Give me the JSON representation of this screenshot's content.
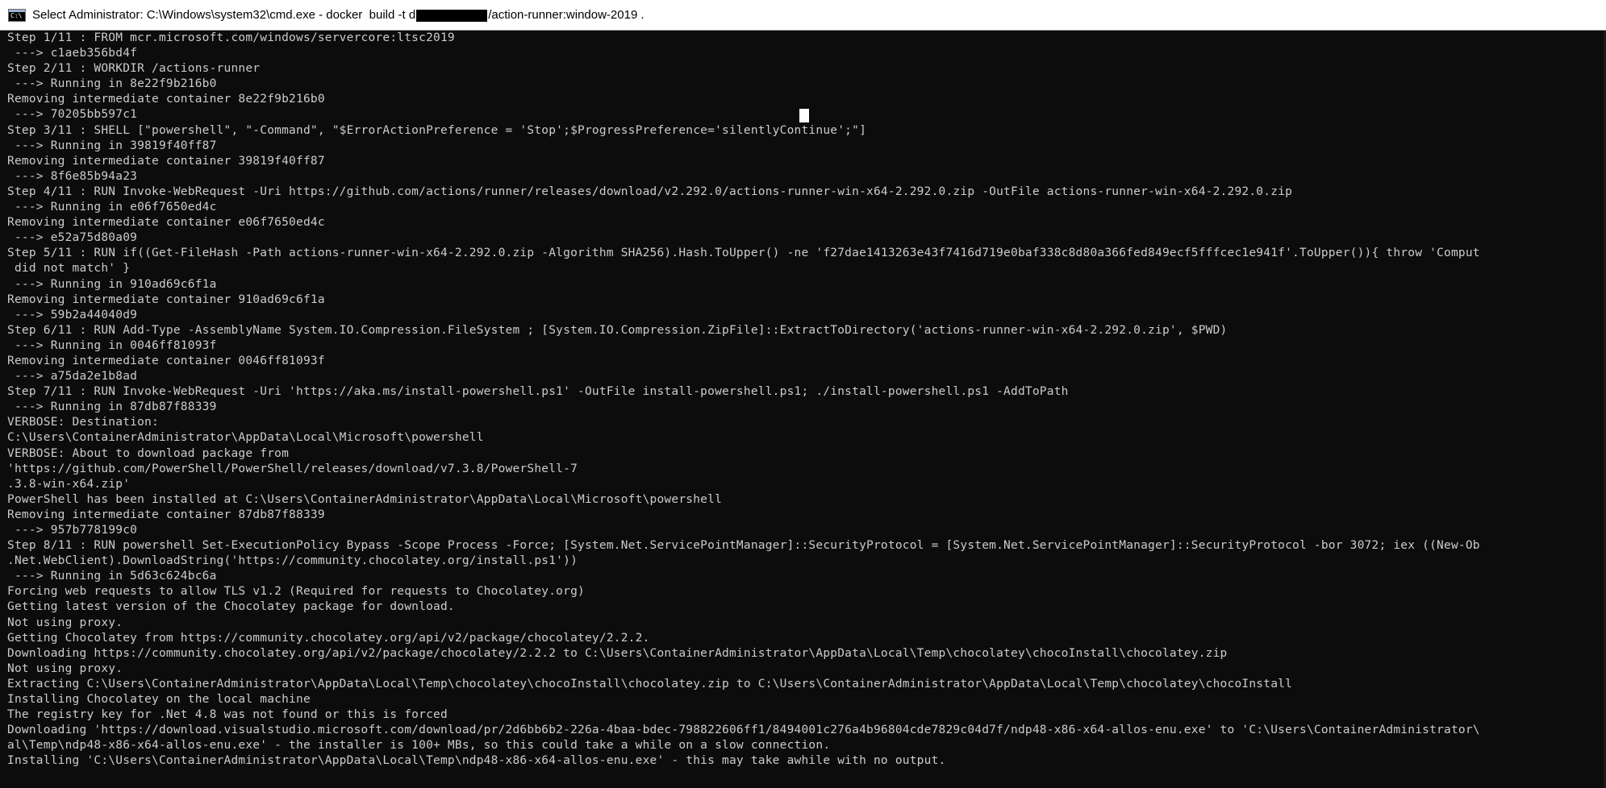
{
  "window": {
    "title_before": "Select Administrator: C:\\Windows\\system32\\cmd.exe - docker  build -t d",
    "title_after": "/action-runner:window-2019 ."
  },
  "icons": {
    "app": "cmd-icon",
    "app_glyph": "C:\\"
  },
  "colors": {
    "console_bg": "#0c0c0c",
    "console_fg": "#cccccc",
    "titlebar_bg": "#ffffff"
  },
  "console": {
    "lines": [
      "Step 1/11 : FROM mcr.microsoft.com/windows/servercore:ltsc2019",
      " ---> c1aeb356bd4f",
      "Step 2/11 : WORKDIR /actions-runner",
      " ---> Running in 8e22f9b216b0",
      "Removing intermediate container 8e22f9b216b0",
      " ---> 70205bb597c1",
      "Step 3/11 : SHELL [\"powershell\", \"-Command\", \"$ErrorActionPreference = 'Stop';$ProgressPreference='silentlyContinue';\"]",
      " ---> Running in 39819f40ff87",
      "Removing intermediate container 39819f40ff87",
      " ---> 8f6e85b94a23",
      "Step 4/11 : RUN Invoke-WebRequest -Uri https://github.com/actions/runner/releases/download/v2.292.0/actions-runner-win-x64-2.292.0.zip -OutFile actions-runner-win-x64-2.292.0.zip",
      " ---> Running in e06f7650ed4c",
      "Removing intermediate container e06f7650ed4c",
      " ---> e52a75d80a09",
      "Step 5/11 : RUN if((Get-FileHash -Path actions-runner-win-x64-2.292.0.zip -Algorithm SHA256).Hash.ToUpper() -ne 'f27dae1413263e43f7416d719e0baf338c8d80a366fed849ecf5fffcec1e941f'.ToUpper()){ throw 'Comput",
      " did not match' }",
      " ---> Running in 910ad69c6f1a",
      "Removing intermediate container 910ad69c6f1a",
      " ---> 59b2a44040d9",
      "Step 6/11 : RUN Add-Type -AssemblyName System.IO.Compression.FileSystem ; [System.IO.Compression.ZipFile]::ExtractToDirectory('actions-runner-win-x64-2.292.0.zip', $PWD)",
      " ---> Running in 0046ff81093f",
      "Removing intermediate container 0046ff81093f",
      " ---> a75da2e1b8ad",
      "Step 7/11 : RUN Invoke-WebRequest -Uri 'https://aka.ms/install-powershell.ps1' -OutFile install-powershell.ps1; ./install-powershell.ps1 -AddToPath",
      " ---> Running in 87db87f88339",
      "VERBOSE: Destination:",
      "C:\\Users\\ContainerAdministrator\\AppData\\Local\\Microsoft\\powershell",
      "VERBOSE: About to download package from",
      "'https://github.com/PowerShell/PowerShell/releases/download/v7.3.8/PowerShell-7",
      ".3.8-win-x64.zip'",
      "PowerShell has been installed at C:\\Users\\ContainerAdministrator\\AppData\\Local\\Microsoft\\powershell",
      "Removing intermediate container 87db87f88339",
      " ---> 957b778199c0",
      "Step 8/11 : RUN powershell Set-ExecutionPolicy Bypass -Scope Process -Force; [System.Net.ServicePointManager]::SecurityProtocol = [System.Net.ServicePointManager]::SecurityProtocol -bor 3072; iex ((New-Ob",
      ".Net.WebClient).DownloadString('https://community.chocolatey.org/install.ps1'))",
      " ---> Running in 5d63c624bc6a",
      "Forcing web requests to allow TLS v1.2 (Required for requests to Chocolatey.org)",
      "Getting latest version of the Chocolatey package for download.",
      "Not using proxy.",
      "Getting Chocolatey from https://community.chocolatey.org/api/v2/package/chocolatey/2.2.2.",
      "Downloading https://community.chocolatey.org/api/v2/package/chocolatey/2.2.2 to C:\\Users\\ContainerAdministrator\\AppData\\Local\\Temp\\chocolatey\\chocoInstall\\chocolatey.zip",
      "Not using proxy.",
      "Extracting C:\\Users\\ContainerAdministrator\\AppData\\Local\\Temp\\chocolatey\\chocoInstall\\chocolatey.zip to C:\\Users\\ContainerAdministrator\\AppData\\Local\\Temp\\chocolatey\\chocoInstall",
      "Installing Chocolatey on the local machine",
      "The registry key for .Net 4.8 was not found or this is forced",
      "Downloading 'https://download.visualstudio.microsoft.com/download/pr/2d6bb6b2-226a-4baa-bdec-798822606ff1/8494001c276a4b96804cde7829c04d7f/ndp48-x86-x64-allos-enu.exe' to 'C:\\Users\\ContainerAdministrator\\",
      "al\\Temp\\ndp48-x86-x64-allos-enu.exe' - the installer is 100+ MBs, so this could take a while on a slow connection.",
      "Installing 'C:\\Users\\ContainerAdministrator\\AppData\\Local\\Temp\\ndp48-x86-x64-allos-enu.exe' - this may take awhile with no output."
    ]
  }
}
